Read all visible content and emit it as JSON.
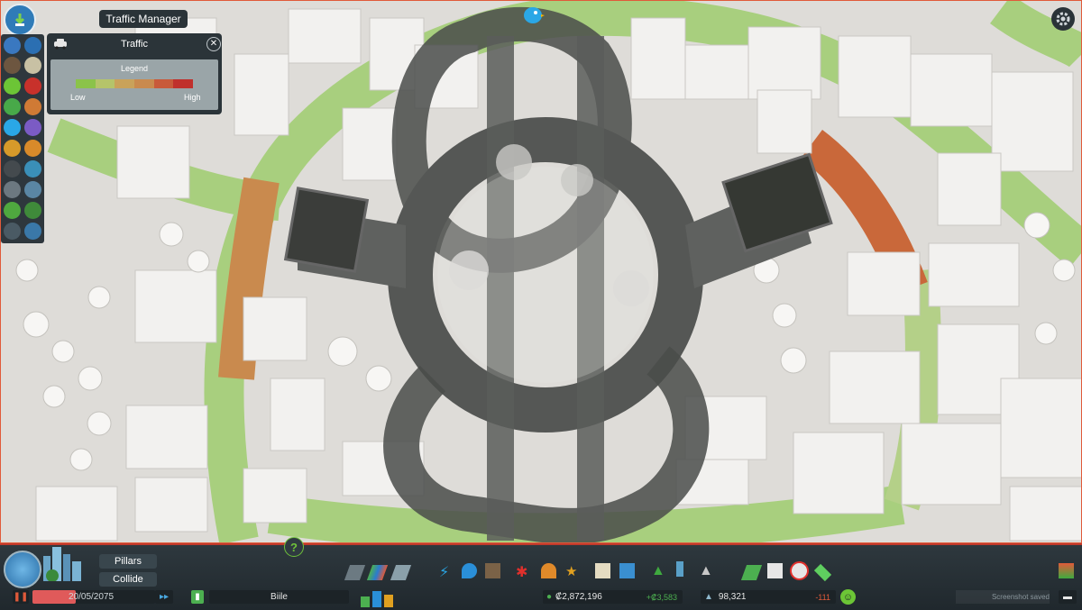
{
  "window": {
    "title": "Traffic Manager"
  },
  "traffic_panel": {
    "title": "Traffic",
    "legend_title": "Legend",
    "low_label": "Low",
    "high_label": "High",
    "gradient": [
      "#8bc34a",
      "#b5c46a",
      "#c9a25a",
      "#c98a4e",
      "#c85a3a",
      "#c0302c"
    ]
  },
  "bottom": {
    "buttons": {
      "pillars": "Pillars",
      "collide": "Collide"
    },
    "date": "20/05/2075",
    "city_name": "Biile",
    "money": "₡2,872,196",
    "income": "+₡3,583",
    "population": "98,321",
    "population_change": "-111",
    "screenshot_note": "Screenshot saved"
  },
  "colors": {
    "accent_red": "#c0392b",
    "money_green": "#4caf50",
    "low_traffic": "#8bc34a",
    "high_traffic": "#c0302c"
  }
}
